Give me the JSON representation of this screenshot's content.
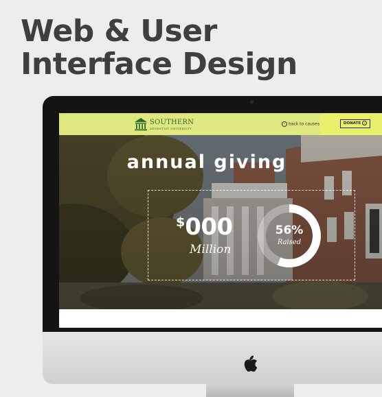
{
  "headline": {
    "line1": "Web & User",
    "line2": "Interface Design"
  },
  "site": {
    "logo_name": "SOUTHERN",
    "logo_subtitle": "ADVENTIST UNIVERSITY",
    "back_link": "back to causes",
    "donate_label": "DONATE",
    "hero_title": "annual giving",
    "currency": "$",
    "amount": "000",
    "amount_unit": "Million",
    "progress_value": "56%",
    "progress_label": "Raised",
    "progress_fraction": 0.56
  },
  "colors": {
    "header_bg": "#dfe87f",
    "donate_bg": "#e9f06a",
    "logo_green": "#2b6a2f",
    "headline_text": "#3f3f3f"
  },
  "icons": [
    "back-arrow-icon",
    "donate-arrow-icon",
    "university-logo-icon",
    "apple-logo-icon"
  ]
}
